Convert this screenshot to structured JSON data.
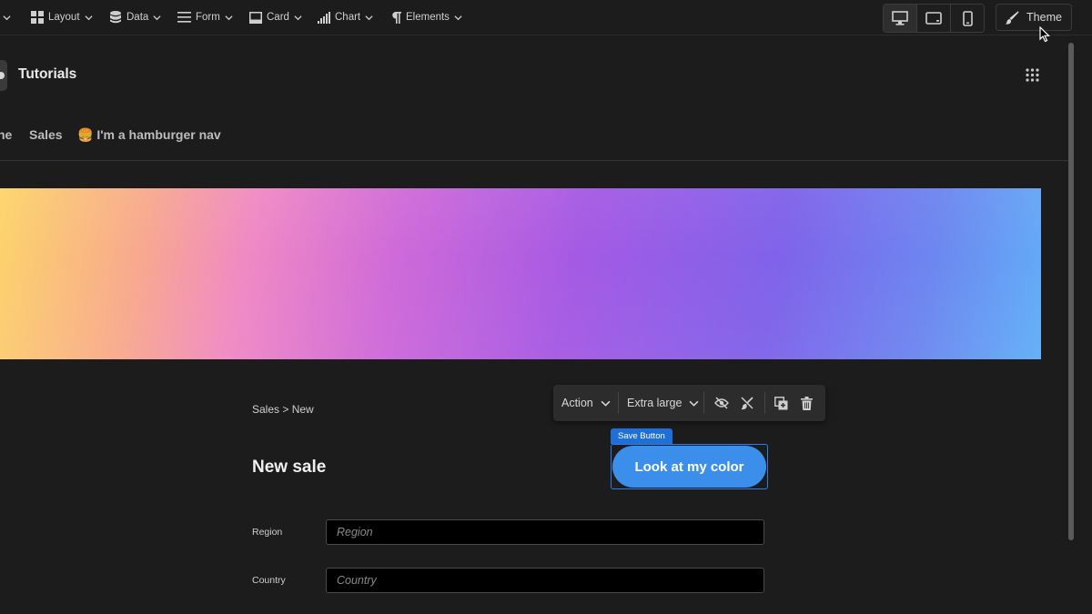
{
  "toolbar": {
    "menus": [
      {
        "label": "Layout",
        "icon": "layout-grid-icon"
      },
      {
        "label": "Data",
        "icon": "database-icon"
      },
      {
        "label": "Form",
        "icon": "form-icon"
      },
      {
        "label": "Card",
        "icon": "card-icon"
      },
      {
        "label": "Chart",
        "icon": "bar-chart-icon"
      },
      {
        "label": "Elements",
        "icon": "pilcrow-icon"
      }
    ],
    "device_modes": [
      "desktop",
      "tablet",
      "mobile"
    ],
    "active_device": "desktop",
    "theme_label": "Theme"
  },
  "app": {
    "title": "Tutorials",
    "nav": [
      {
        "label": "ne"
      },
      {
        "label": "Sales"
      },
      {
        "label": "🍔 I'm a hamburger nav"
      }
    ]
  },
  "form": {
    "breadcrumb": "Sales > New",
    "title": "New sale",
    "fields": [
      {
        "label": "Region",
        "placeholder": "Region",
        "value": ""
      },
      {
        "label": "Country",
        "placeholder": "Country",
        "value": ""
      }
    ]
  },
  "editor": {
    "action_label": "Action",
    "size_label": "Extra large",
    "component_tag": "Save Button",
    "button_label": "Look at my color"
  },
  "colors": {
    "accent": "#3b8fea",
    "selection": "#2b7de9",
    "background": "#1c1c1c"
  }
}
